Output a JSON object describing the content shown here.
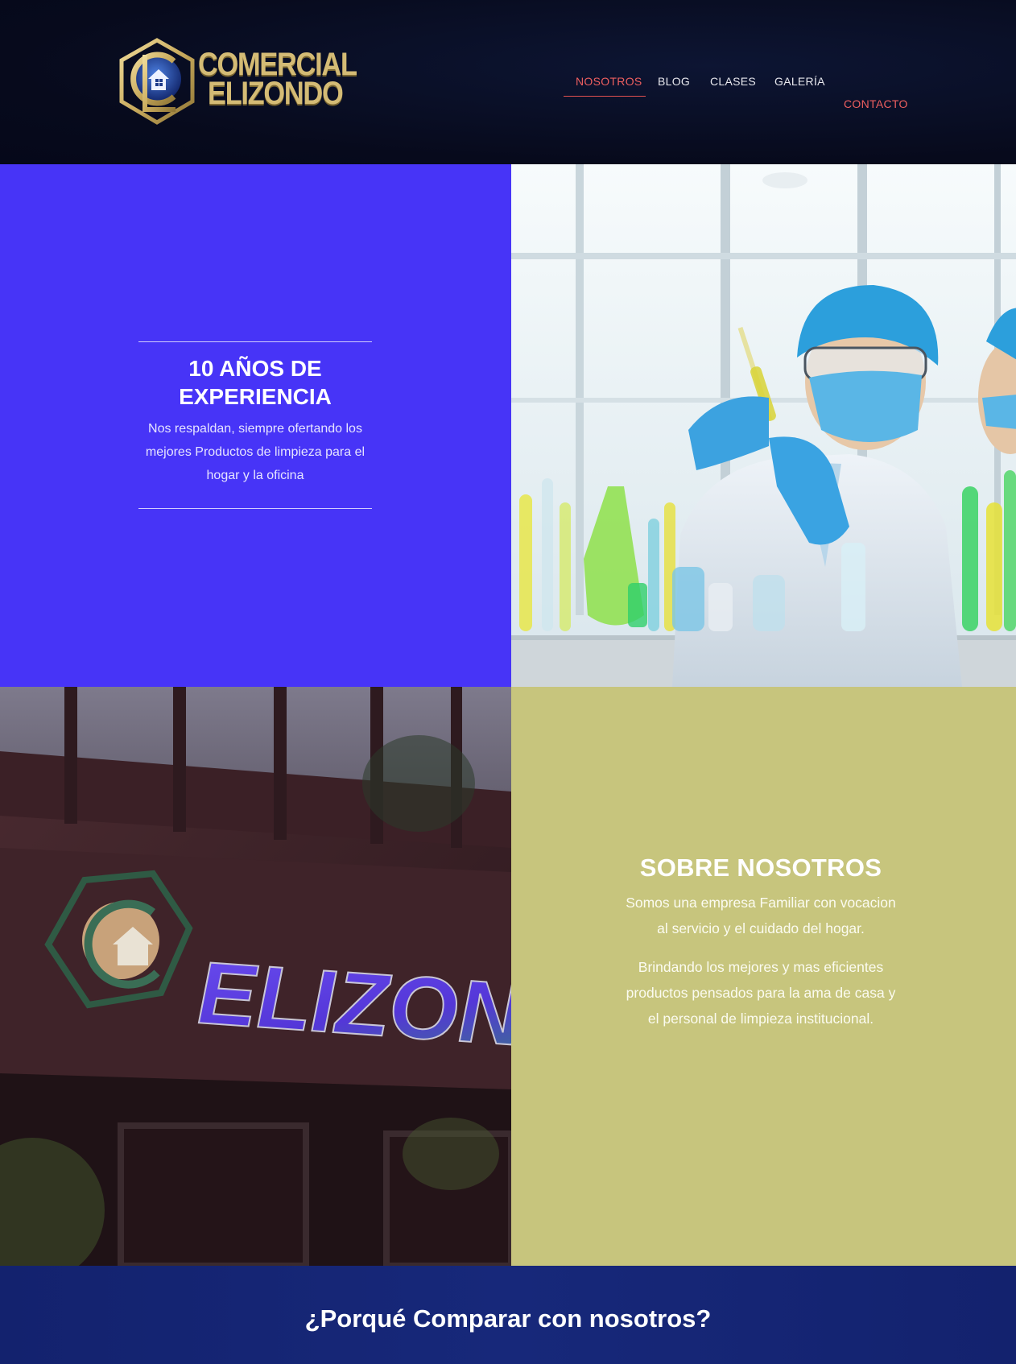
{
  "brand": {
    "line1": "COMERCIAL",
    "line2": "ELIZONDO",
    "colors": {
      "gold": "#d4bb75",
      "navy": "#070a1c"
    }
  },
  "nav": {
    "items": [
      "NOSOTROS",
      "BLOG",
      "CLASES",
      "GALERÍA",
      "CONTACTO"
    ],
    "active": "NOSOTROS",
    "active_color": "#ee5f5f"
  },
  "experience": {
    "title_line1": "10 AÑOS DE",
    "title_line2": "EXPERIENCIA",
    "body": "Nos respaldan, siempre ofertando los mejores Productos de limpieza para el hogar y la oficina",
    "bg_color": "#4734f7"
  },
  "about": {
    "title": "SOBRE NOSOTROS",
    "paragraph1": "Somos una empresa Familiar con vocacion al servicio y el cuidado del hogar.",
    "paragraph2": "Brindando los mejores y mas eficientes productos pensados para la ama de casa y el personal de limpieza institucional.",
    "bg_color": "#c7c57d"
  },
  "signage": {
    "text": "ELIZONDO"
  },
  "why": {
    "title": "¿Porqué Comparar con nosotros?"
  }
}
